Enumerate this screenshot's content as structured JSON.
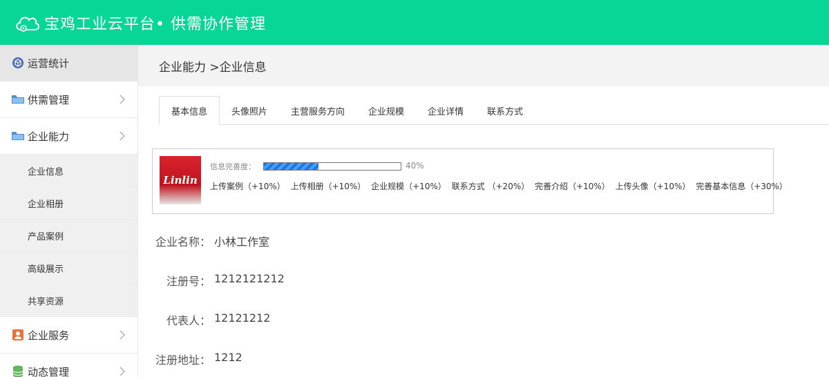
{
  "header": {
    "title": "宝鸡工业云平台• 供需协作管理"
  },
  "sidebar": {
    "items": [
      {
        "label": "运营统计",
        "icon": "cube-icon",
        "active": true
      },
      {
        "label": "供需管理",
        "icon": "folder-icon"
      },
      {
        "label": "企业能力",
        "icon": "folder-icon"
      },
      {
        "label": "企业服务",
        "icon": "user-card-icon"
      },
      {
        "label": "动态管理",
        "icon": "database-icon"
      }
    ],
    "subitems": [
      "企业信息",
      "企业相册",
      "产品案例",
      "高级展示",
      "共享资源"
    ]
  },
  "breadcrumb": "企业能力 >企业信息",
  "tabs": [
    "基本信息",
    "头像照片",
    "主营服务方向",
    "企业规模",
    "企业详情",
    "联系方式"
  ],
  "completeness": {
    "logo_text": "Linlin",
    "label": "信息完善度：",
    "percent": 40,
    "percent_text": "40%",
    "tips": [
      "上传案例（+10%）",
      "上传相册（+10%）",
      "企业规模（+10%）",
      "联系方式 （+20%）",
      "完善介绍（+10%）",
      "上传头像（+10%）",
      "完善基本信息（+30%）"
    ]
  },
  "fields": [
    {
      "label": "企业名称：",
      "value": "小林工作室"
    },
    {
      "label": "注册号：",
      "value": "1212121212"
    },
    {
      "label": "代表人：",
      "value": "12121212"
    },
    {
      "label": "注册地址：",
      "value": "1212"
    }
  ],
  "colors": {
    "header": "#07d696",
    "progress": "#1a78e6"
  }
}
